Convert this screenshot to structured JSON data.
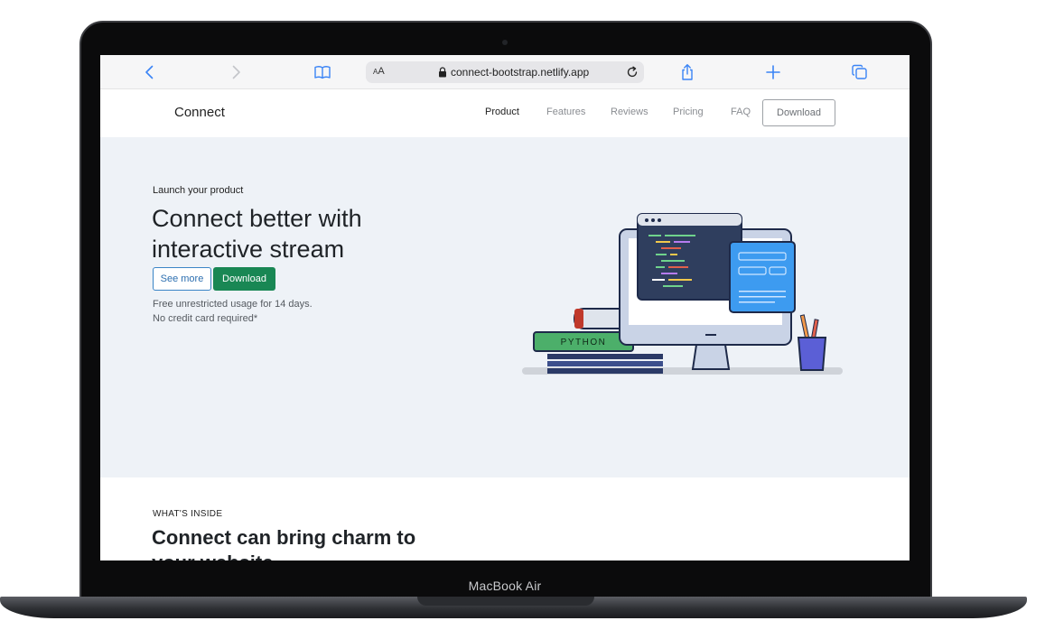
{
  "device": {
    "label": "MacBook Air"
  },
  "browser": {
    "url": "connect-bootstrap.netlify.app",
    "text_size_label": "AA"
  },
  "nav": {
    "brand": "Connect",
    "links": [
      "Product",
      "Features",
      "Reviews",
      "Pricing",
      "FAQ"
    ],
    "active_link": "Product",
    "download_label": "Download"
  },
  "hero": {
    "eyebrow": "Launch your product",
    "title": "Connect better with interactive stream",
    "see_more_label": "See more",
    "download_label": "Download",
    "note_line1": "Free unrestricted usage for 14 days.",
    "note_line2": "No credit card required*",
    "book_label": "PYTHON"
  },
  "inside": {
    "eyebrow": "WHAT'S INSIDE",
    "title": "Connect can bring charm to your website"
  },
  "colors": {
    "accent_blue": "#3a84f6",
    "primary_green": "#198754",
    "hero_bg": "#eef2f7"
  }
}
